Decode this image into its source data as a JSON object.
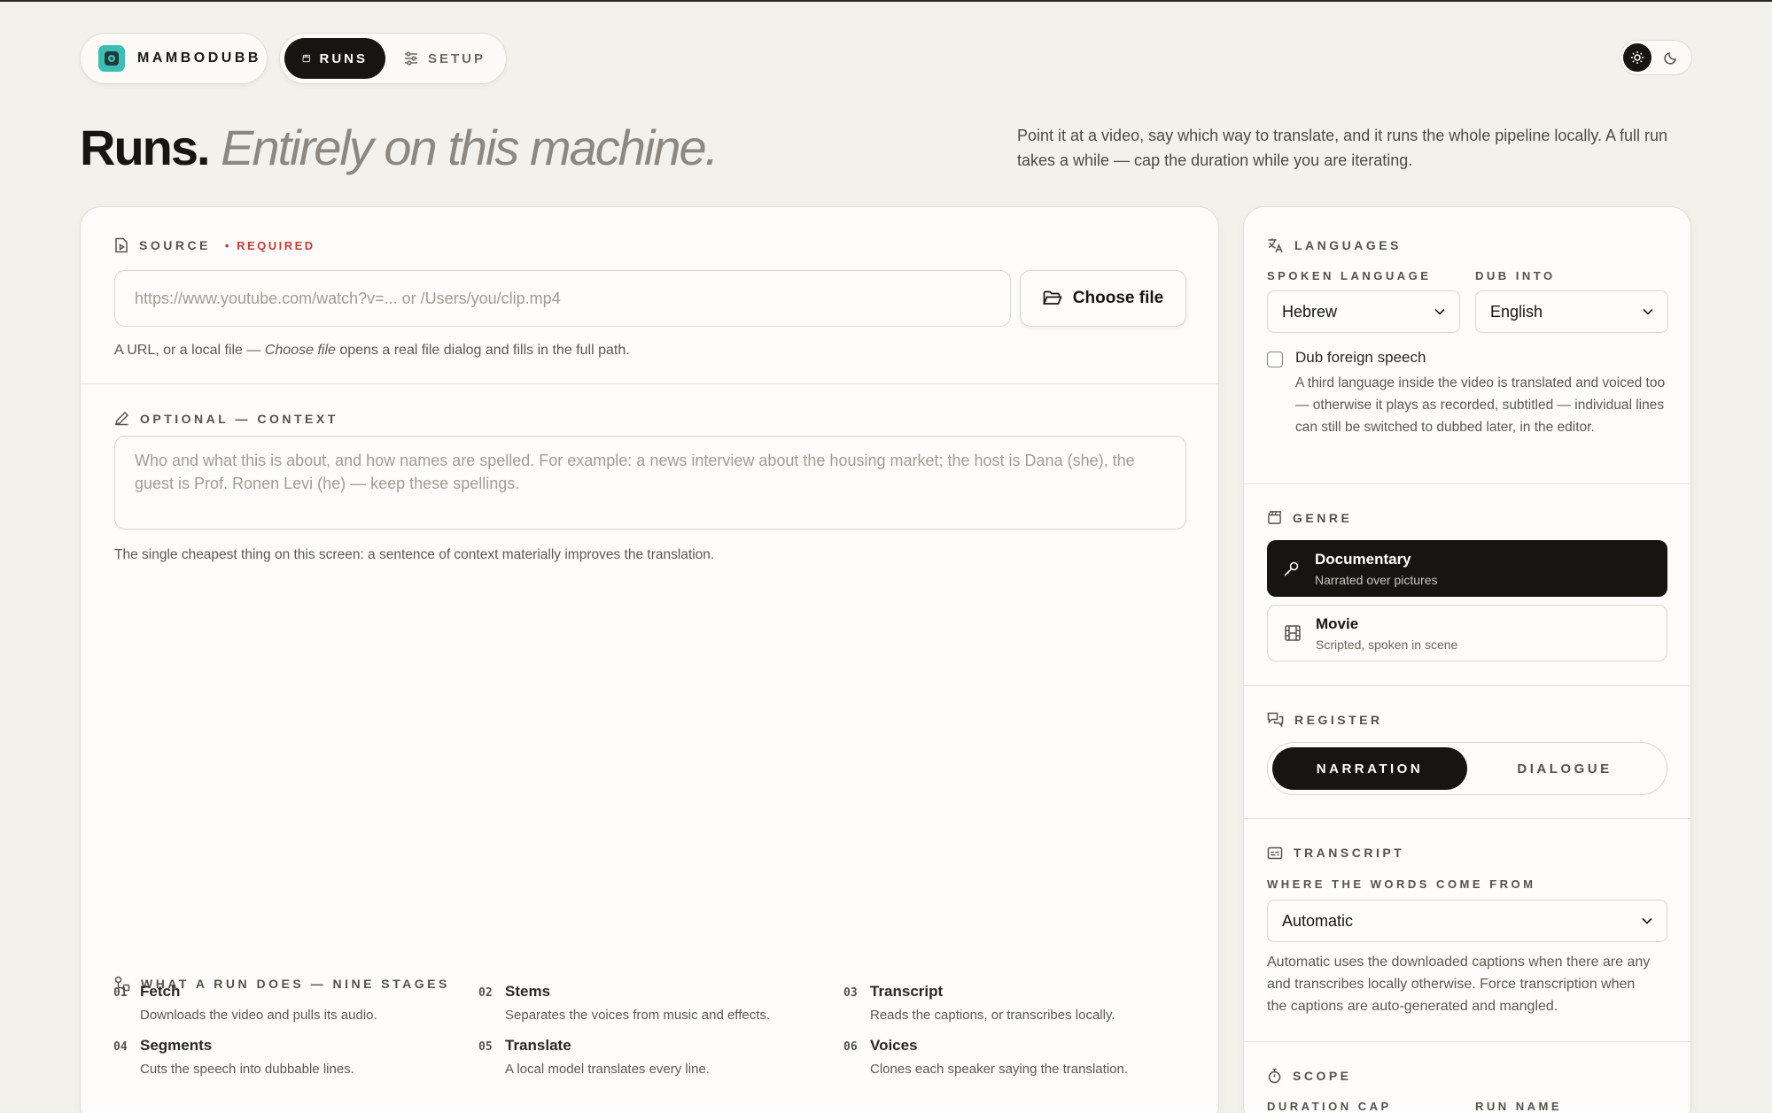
{
  "brand": {
    "name": "MAMBODUBB"
  },
  "nav": {
    "runs": "RUNS",
    "setup": "SETUP"
  },
  "header": {
    "title_bold": "Runs.",
    "title_italic": "Entirely on this machine.",
    "intro": "Point it at a video, say which way to translate, and it runs the whole pipeline locally. A full run takes a while — cap the duration while you are iterating."
  },
  "source": {
    "label": "SOURCE",
    "required": "• REQUIRED",
    "placeholder": "https://www.youtube.com/watch?v=... or /Users/you/clip.mp4",
    "value": "",
    "choose_file": "Choose file",
    "help_pre": "A URL, or a local file — ",
    "help_em": "Choose file",
    "help_post": " opens a real file dialog and fills in the full path."
  },
  "context": {
    "label": "OPTIONAL — CONTEXT",
    "placeholder": "Who and what this is about, and how names are spelled. For example: a news interview about the housing market; the host is Dana (she), the guest is Prof. Ronen Levi (he) — keep these spellings.",
    "value": "",
    "help": "The single cheapest thing on this screen: a sentence of context materially improves the translation."
  },
  "stages": {
    "label": "WHAT A RUN DOES — NINE STAGES",
    "items": [
      {
        "num": "01",
        "name": "Fetch",
        "desc": "Downloads the video and pulls its audio."
      },
      {
        "num": "02",
        "name": "Stems",
        "desc": "Separates the voices from music and effects."
      },
      {
        "num": "03",
        "name": "Transcript",
        "desc": "Reads the captions, or transcribes locally."
      },
      {
        "num": "04",
        "name": "Segments",
        "desc": "Cuts the speech into dubbable lines."
      },
      {
        "num": "05",
        "name": "Translate",
        "desc": "A local model translates every line."
      },
      {
        "num": "06",
        "name": "Voices",
        "desc": "Clones each speaker saying the translation."
      }
    ]
  },
  "languages": {
    "label": "LANGUAGES",
    "spoken_label": "SPOKEN LANGUAGE",
    "spoken_value": "Hebrew",
    "dub_label": "DUB INTO",
    "dub_value": "English",
    "foreign_label": "Dub foreign speech",
    "foreign_checked": false,
    "foreign_desc": "A third language inside the video is translated and voiced too — otherwise it plays as recorded, subtitled — individual lines can still be switched to dubbed later, in the editor."
  },
  "genre": {
    "label": "GENRE",
    "options": [
      {
        "title": "Documentary",
        "sub": "Narrated over pictures",
        "selected": true
      },
      {
        "title": "Movie",
        "sub": "Scripted, spoken in scene",
        "selected": false
      }
    ]
  },
  "register": {
    "label": "REGISTER",
    "options": [
      "NARRATION",
      "DIALOGUE"
    ],
    "selected": "NARRATION"
  },
  "transcript": {
    "label": "TRANSCRIPT",
    "source_label": "WHERE THE WORDS COME FROM",
    "source_value": "Automatic",
    "desc": "Automatic uses the downloaded captions when there are any and transcribes locally otherwise. Force transcription when the captions are auto-generated and mangled."
  },
  "scope": {
    "label": "SCOPE",
    "duration_label": "DURATION CAP",
    "run_name_label": "RUN NAME"
  },
  "colors": {
    "ink": "#161512",
    "bg": "#f3f1ec",
    "required": "#c93a32",
    "brand_logo": "#3bbfb2"
  }
}
